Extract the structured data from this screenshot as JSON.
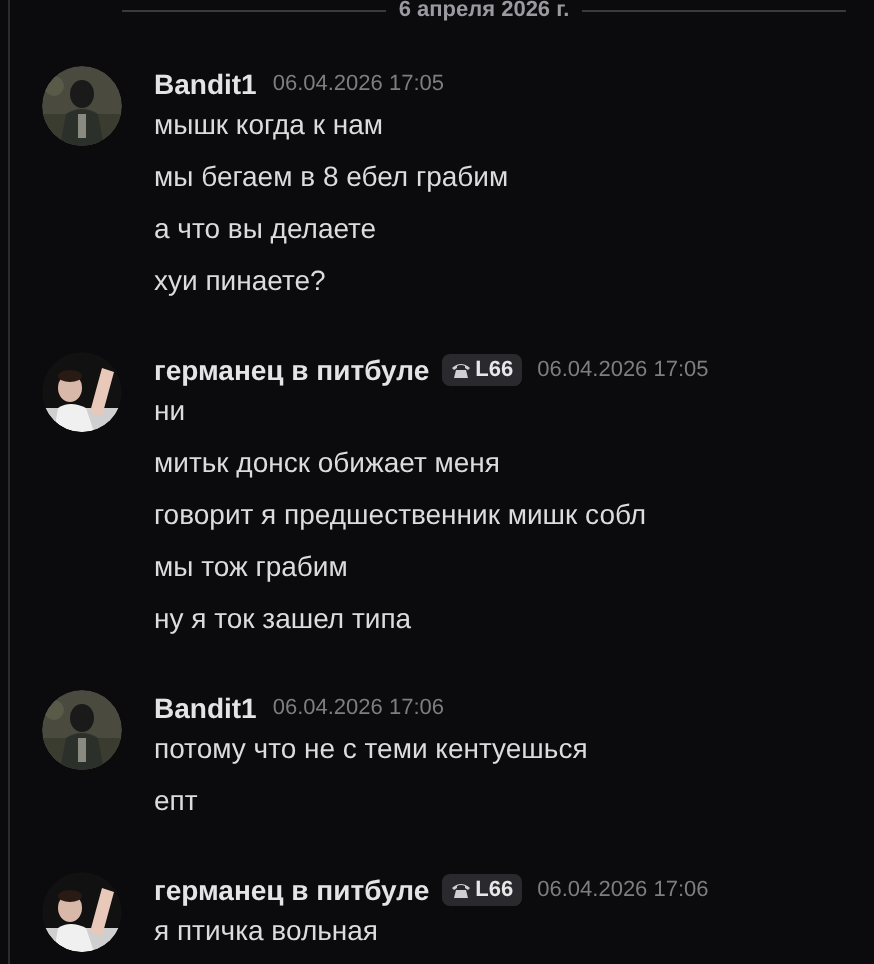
{
  "date_divider": "6 апреля 2026 г.",
  "messages": [
    {
      "author": "Bandit1",
      "avatar": {
        "kind": "picture"
      },
      "timestamp": "06.04.2026 17:05",
      "lines": [
        "мышк когда к нам",
        "мы бегаем в 8 ебел грабим",
        "а что вы делаете",
        "хуи пинаете?"
      ]
    },
    {
      "author": "германец в питбуле",
      "avatar": {
        "kind": "picture"
      },
      "badge": "L66",
      "timestamp": "06.04.2026 17:05",
      "lines": [
        "ни",
        "митьк донск обижает меня",
        "говорит я предшественник мишк собл",
        "мы тож грабим",
        "ну я ток зашел типа"
      ]
    },
    {
      "author": "Bandit1",
      "avatar": {
        "kind": "picture"
      },
      "timestamp": "06.04.2026 17:06",
      "lines": [
        "потому что не с теми кентуешься",
        "епт"
      ]
    },
    {
      "author": "германец в питбуле",
      "avatar": {
        "kind": "picture"
      },
      "badge": "L66",
      "timestamp": "06.04.2026 17:06",
      "lines": [
        "я птичка вольная"
      ]
    }
  ]
}
